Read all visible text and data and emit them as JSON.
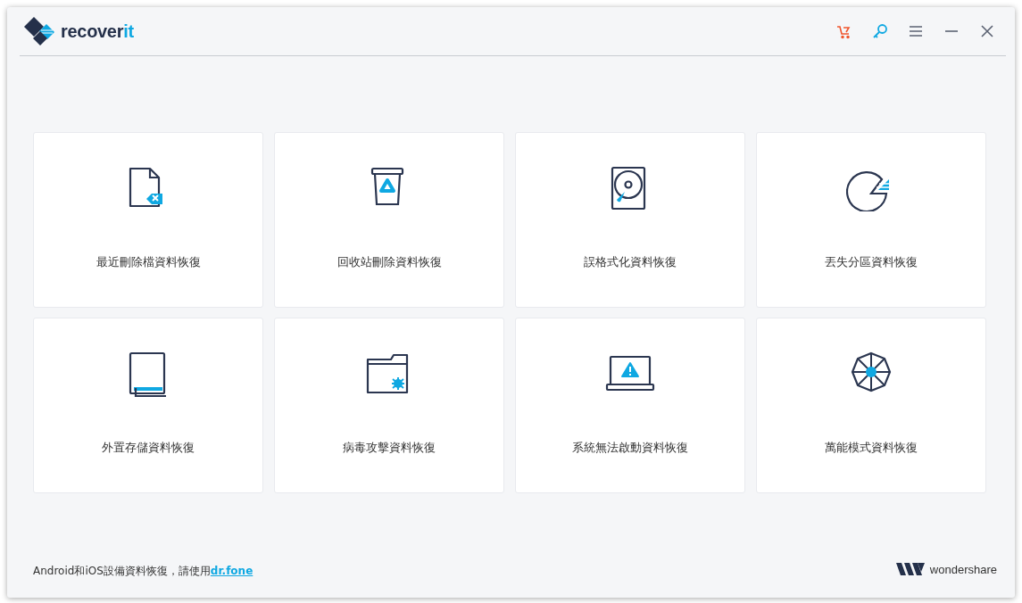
{
  "header": {
    "logo": {
      "text": "recover",
      "accent": "it"
    }
  },
  "modes": [
    {
      "kind": "deleted-file",
      "label": "最近刪除檔資料恢復"
    },
    {
      "kind": "recycle-bin",
      "label": "回收站刪除資料恢復"
    },
    {
      "kind": "hard-disk",
      "label": "誤格式化資料恢復"
    },
    {
      "kind": "partition",
      "label": "丟失分區資料恢復"
    },
    {
      "kind": "external",
      "label": "外置存儲資料恢復"
    },
    {
      "kind": "virus",
      "label": "病毒攻擊資料恢復"
    },
    {
      "kind": "crash",
      "label": "系統無法啟動資料恢復"
    },
    {
      "kind": "all-round",
      "label": "萬能模式資料恢復"
    }
  ],
  "footer": {
    "note": "Android和iOS設備資料恢復，請使用",
    "link": "dr.fone",
    "brand": "wondershare"
  }
}
